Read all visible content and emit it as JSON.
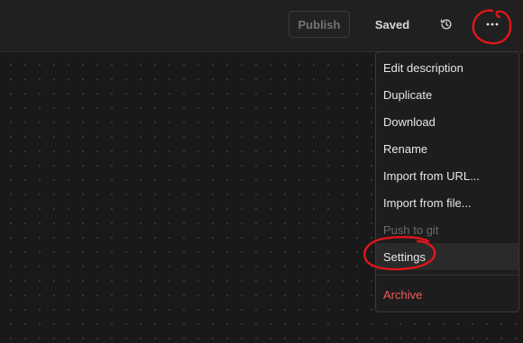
{
  "toolbar": {
    "publish_label": "Publish",
    "saved_label": "Saved",
    "history_icon": "history-icon",
    "more_icon": "more-horizontal-icon"
  },
  "menu": {
    "items": [
      {
        "label": "Edit description",
        "state": "normal"
      },
      {
        "label": "Duplicate",
        "state": "normal"
      },
      {
        "label": "Download",
        "state": "normal"
      },
      {
        "label": "Rename",
        "state": "normal"
      },
      {
        "label": "Import from URL...",
        "state": "normal"
      },
      {
        "label": "Import from file...",
        "state": "normal"
      },
      {
        "label": "Push to git",
        "state": "disabled"
      },
      {
        "label": "Settings",
        "state": "hovered"
      },
      {
        "label": "Archive",
        "state": "danger"
      }
    ]
  },
  "colors": {
    "background": "#191919",
    "topbar": "#202020",
    "menu_background": "#1d1d1d",
    "danger": "#ef5b5b",
    "annotation": "#e0161b"
  }
}
